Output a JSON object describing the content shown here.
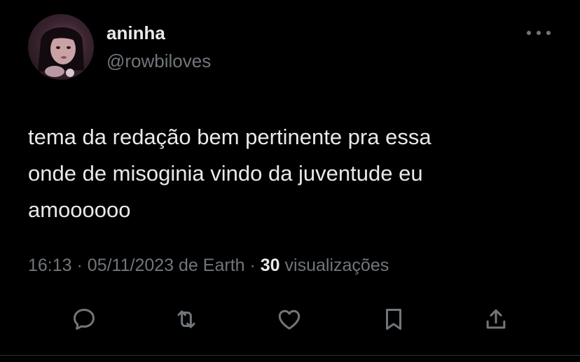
{
  "user": {
    "display_name": "aninha",
    "handle": "@rowbiloves",
    "avatar_icon": "profile-photo"
  },
  "tweet": {
    "text": "tema da redação bem pertinente pra essa\nonde de misoginia vindo da juventude eu\namoooooo"
  },
  "meta": {
    "time": "16:13",
    "separator": "·",
    "date": "05/11/2023",
    "source": "de Earth",
    "views_count": "30",
    "views_label": "visualizações"
  },
  "actions": {
    "icons": [
      "reply-icon",
      "retweet-icon",
      "like-icon",
      "bookmark-icon",
      "share-icon"
    ]
  },
  "colors": {
    "background": "#000000",
    "primary_text": "#e7e9ea",
    "secondary_text": "#71767b"
  }
}
